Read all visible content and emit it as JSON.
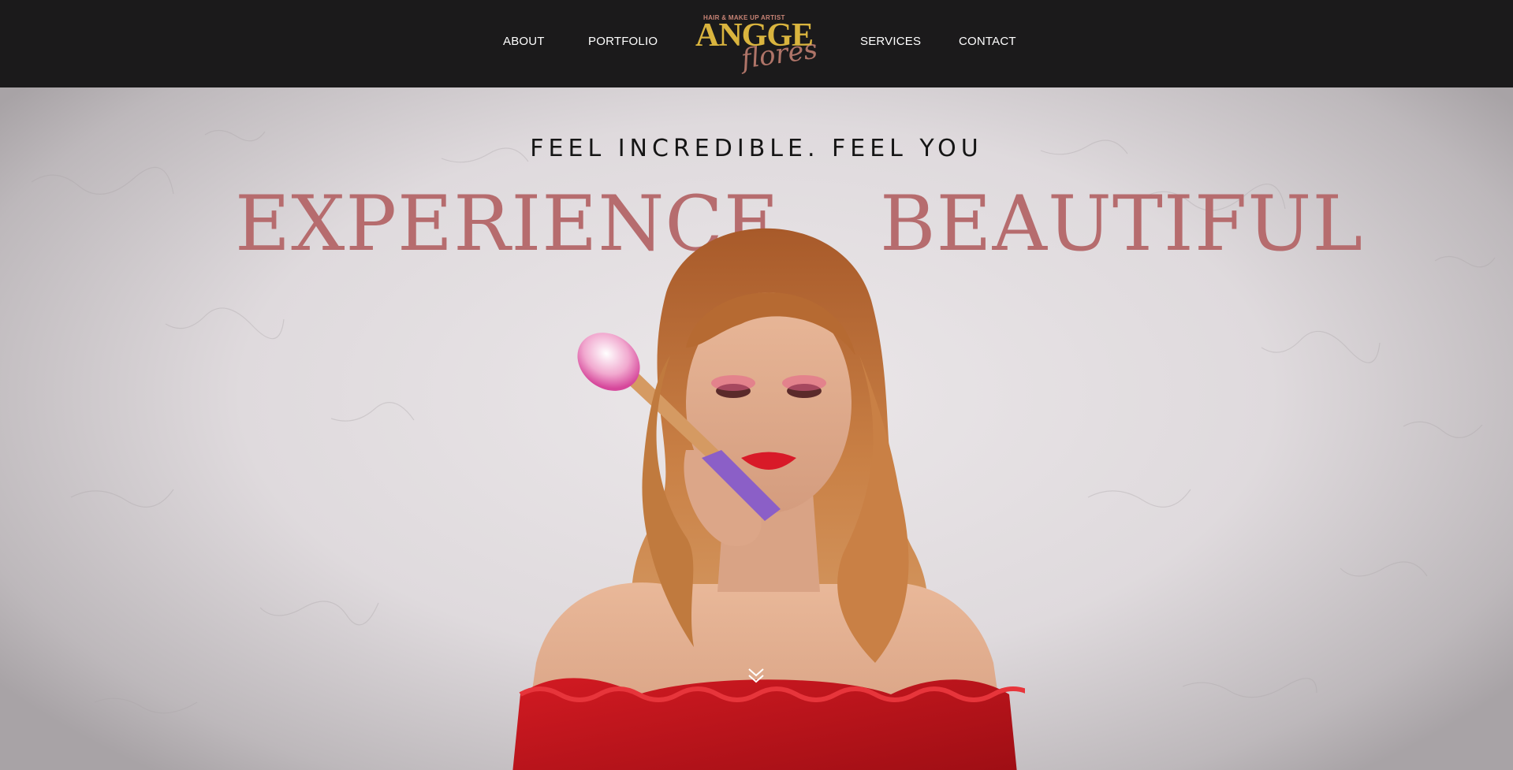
{
  "nav": {
    "about": "ABOUT",
    "portfolio": "PORTFOLIO",
    "services": "SERVICES",
    "contact": "CONTACT"
  },
  "logo": {
    "tagline": "HAIR & MAKE UP ARTIST",
    "name": "ANGGE",
    "script": "flores"
  },
  "hero": {
    "tagline": "FEEL INCREDIBLE. FEEL YOU",
    "headline_left": "EXPERIENCE",
    "headline_right": "BEAUTIFUL"
  },
  "icons": {
    "scroll": "chevron-double-down-icon"
  },
  "colors": {
    "nav_bg": "#1b1a1b",
    "logo_gold": "#d9b43e",
    "accent_rose": "#b66c6e",
    "dress_red": "#c2141c"
  }
}
